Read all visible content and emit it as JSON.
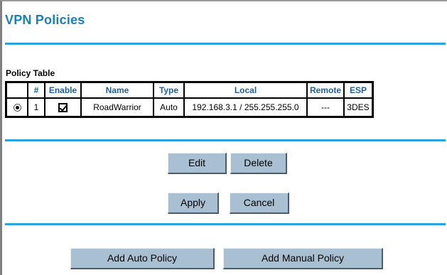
{
  "page": {
    "title": "VPN Policies",
    "section_label": "Policy Table"
  },
  "table": {
    "headers": [
      "",
      "#",
      "Enable",
      "Name",
      "Type",
      "Local",
      "Remote",
      "ESP"
    ],
    "rows": [
      {
        "selected": true,
        "number": "1",
        "enabled": true,
        "name": "RoadWarrior",
        "type": "Auto",
        "local": "192.168.3.1 / 255.255.255.0",
        "remote": "---",
        "esp": "3DES"
      }
    ]
  },
  "buttons": {
    "edit": "Edit",
    "delete": "Delete",
    "apply": "Apply",
    "cancel": "Cancel",
    "add_auto": "Add Auto Policy",
    "add_manual": "Add Manual Policy"
  },
  "colors": {
    "title": "#1c7fb7",
    "rule": "#29a3dc",
    "header_text": "#1c5fa8",
    "button_face": "#a9bfd2"
  },
  "icons": {
    "row_select": "radio-selected",
    "row_enable": "checkbox-checked"
  }
}
